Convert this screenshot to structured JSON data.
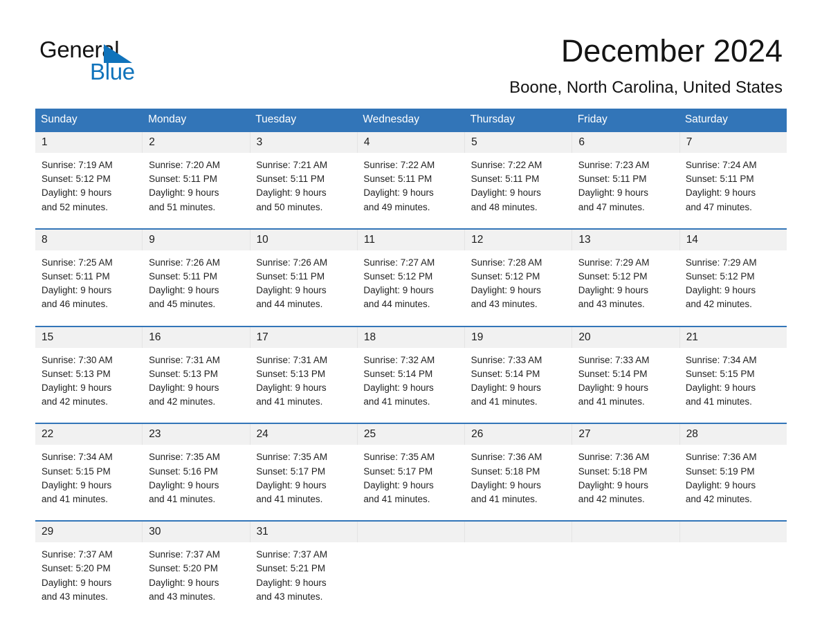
{
  "brand": {
    "name_part1": "General",
    "name_part2": "Blue",
    "accent_color": "#1073bb"
  },
  "header": {
    "title": "December 2024",
    "location": "Boone, North Carolina, United States"
  },
  "calendar": {
    "header_color": "#3275b8",
    "weekdays": [
      "Sunday",
      "Monday",
      "Tuesday",
      "Wednesday",
      "Thursday",
      "Friday",
      "Saturday"
    ],
    "weeks": [
      [
        {
          "day": "1",
          "sunrise": "Sunrise: 7:19 AM",
          "sunset": "Sunset: 5:12 PM",
          "daylight_line1": "Daylight: 9 hours",
          "daylight_line2": "and 52 minutes."
        },
        {
          "day": "2",
          "sunrise": "Sunrise: 7:20 AM",
          "sunset": "Sunset: 5:11 PM",
          "daylight_line1": "Daylight: 9 hours",
          "daylight_line2": "and 51 minutes."
        },
        {
          "day": "3",
          "sunrise": "Sunrise: 7:21 AM",
          "sunset": "Sunset: 5:11 PM",
          "daylight_line1": "Daylight: 9 hours",
          "daylight_line2": "and 50 minutes."
        },
        {
          "day": "4",
          "sunrise": "Sunrise: 7:22 AM",
          "sunset": "Sunset: 5:11 PM",
          "daylight_line1": "Daylight: 9 hours",
          "daylight_line2": "and 49 minutes."
        },
        {
          "day": "5",
          "sunrise": "Sunrise: 7:22 AM",
          "sunset": "Sunset: 5:11 PM",
          "daylight_line1": "Daylight: 9 hours",
          "daylight_line2": "and 48 minutes."
        },
        {
          "day": "6",
          "sunrise": "Sunrise: 7:23 AM",
          "sunset": "Sunset: 5:11 PM",
          "daylight_line1": "Daylight: 9 hours",
          "daylight_line2": "and 47 minutes."
        },
        {
          "day": "7",
          "sunrise": "Sunrise: 7:24 AM",
          "sunset": "Sunset: 5:11 PM",
          "daylight_line1": "Daylight: 9 hours",
          "daylight_line2": "and 47 minutes."
        }
      ],
      [
        {
          "day": "8",
          "sunrise": "Sunrise: 7:25 AM",
          "sunset": "Sunset: 5:11 PM",
          "daylight_line1": "Daylight: 9 hours",
          "daylight_line2": "and 46 minutes."
        },
        {
          "day": "9",
          "sunrise": "Sunrise: 7:26 AM",
          "sunset": "Sunset: 5:11 PM",
          "daylight_line1": "Daylight: 9 hours",
          "daylight_line2": "and 45 minutes."
        },
        {
          "day": "10",
          "sunrise": "Sunrise: 7:26 AM",
          "sunset": "Sunset: 5:11 PM",
          "daylight_line1": "Daylight: 9 hours",
          "daylight_line2": "and 44 minutes."
        },
        {
          "day": "11",
          "sunrise": "Sunrise: 7:27 AM",
          "sunset": "Sunset: 5:12 PM",
          "daylight_line1": "Daylight: 9 hours",
          "daylight_line2": "and 44 minutes."
        },
        {
          "day": "12",
          "sunrise": "Sunrise: 7:28 AM",
          "sunset": "Sunset: 5:12 PM",
          "daylight_line1": "Daylight: 9 hours",
          "daylight_line2": "and 43 minutes."
        },
        {
          "day": "13",
          "sunrise": "Sunrise: 7:29 AM",
          "sunset": "Sunset: 5:12 PM",
          "daylight_line1": "Daylight: 9 hours",
          "daylight_line2": "and 43 minutes."
        },
        {
          "day": "14",
          "sunrise": "Sunrise: 7:29 AM",
          "sunset": "Sunset: 5:12 PM",
          "daylight_line1": "Daylight: 9 hours",
          "daylight_line2": "and 42 minutes."
        }
      ],
      [
        {
          "day": "15",
          "sunrise": "Sunrise: 7:30 AM",
          "sunset": "Sunset: 5:13 PM",
          "daylight_line1": "Daylight: 9 hours",
          "daylight_line2": "and 42 minutes."
        },
        {
          "day": "16",
          "sunrise": "Sunrise: 7:31 AM",
          "sunset": "Sunset: 5:13 PM",
          "daylight_line1": "Daylight: 9 hours",
          "daylight_line2": "and 42 minutes."
        },
        {
          "day": "17",
          "sunrise": "Sunrise: 7:31 AM",
          "sunset": "Sunset: 5:13 PM",
          "daylight_line1": "Daylight: 9 hours",
          "daylight_line2": "and 41 minutes."
        },
        {
          "day": "18",
          "sunrise": "Sunrise: 7:32 AM",
          "sunset": "Sunset: 5:14 PM",
          "daylight_line1": "Daylight: 9 hours",
          "daylight_line2": "and 41 minutes."
        },
        {
          "day": "19",
          "sunrise": "Sunrise: 7:33 AM",
          "sunset": "Sunset: 5:14 PM",
          "daylight_line1": "Daylight: 9 hours",
          "daylight_line2": "and 41 minutes."
        },
        {
          "day": "20",
          "sunrise": "Sunrise: 7:33 AM",
          "sunset": "Sunset: 5:14 PM",
          "daylight_line1": "Daylight: 9 hours",
          "daylight_line2": "and 41 minutes."
        },
        {
          "day": "21",
          "sunrise": "Sunrise: 7:34 AM",
          "sunset": "Sunset: 5:15 PM",
          "daylight_line1": "Daylight: 9 hours",
          "daylight_line2": "and 41 minutes."
        }
      ],
      [
        {
          "day": "22",
          "sunrise": "Sunrise: 7:34 AM",
          "sunset": "Sunset: 5:15 PM",
          "daylight_line1": "Daylight: 9 hours",
          "daylight_line2": "and 41 minutes."
        },
        {
          "day": "23",
          "sunrise": "Sunrise: 7:35 AM",
          "sunset": "Sunset: 5:16 PM",
          "daylight_line1": "Daylight: 9 hours",
          "daylight_line2": "and 41 minutes."
        },
        {
          "day": "24",
          "sunrise": "Sunrise: 7:35 AM",
          "sunset": "Sunset: 5:17 PM",
          "daylight_line1": "Daylight: 9 hours",
          "daylight_line2": "and 41 minutes."
        },
        {
          "day": "25",
          "sunrise": "Sunrise: 7:35 AM",
          "sunset": "Sunset: 5:17 PM",
          "daylight_line1": "Daylight: 9 hours",
          "daylight_line2": "and 41 minutes."
        },
        {
          "day": "26",
          "sunrise": "Sunrise: 7:36 AM",
          "sunset": "Sunset: 5:18 PM",
          "daylight_line1": "Daylight: 9 hours",
          "daylight_line2": "and 41 minutes."
        },
        {
          "day": "27",
          "sunrise": "Sunrise: 7:36 AM",
          "sunset": "Sunset: 5:18 PM",
          "daylight_line1": "Daylight: 9 hours",
          "daylight_line2": "and 42 minutes."
        },
        {
          "day": "28",
          "sunrise": "Sunrise: 7:36 AM",
          "sunset": "Sunset: 5:19 PM",
          "daylight_line1": "Daylight: 9 hours",
          "daylight_line2": "and 42 minutes."
        }
      ],
      [
        {
          "day": "29",
          "sunrise": "Sunrise: 7:37 AM",
          "sunset": "Sunset: 5:20 PM",
          "daylight_line1": "Daylight: 9 hours",
          "daylight_line2": "and 43 minutes."
        },
        {
          "day": "30",
          "sunrise": "Sunrise: 7:37 AM",
          "sunset": "Sunset: 5:20 PM",
          "daylight_line1": "Daylight: 9 hours",
          "daylight_line2": "and 43 minutes."
        },
        {
          "day": "31",
          "sunrise": "Sunrise: 7:37 AM",
          "sunset": "Sunset: 5:21 PM",
          "daylight_line1": "Daylight: 9 hours",
          "daylight_line2": "and 43 minutes."
        },
        {
          "day": "",
          "sunrise": "",
          "sunset": "",
          "daylight_line1": "",
          "daylight_line2": ""
        },
        {
          "day": "",
          "sunrise": "",
          "sunset": "",
          "daylight_line1": "",
          "daylight_line2": ""
        },
        {
          "day": "",
          "sunrise": "",
          "sunset": "",
          "daylight_line1": "",
          "daylight_line2": ""
        },
        {
          "day": "",
          "sunrise": "",
          "sunset": "",
          "daylight_line1": "",
          "daylight_line2": ""
        }
      ]
    ]
  }
}
